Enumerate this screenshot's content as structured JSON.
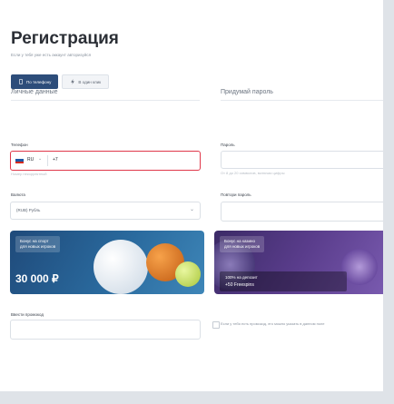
{
  "title": "Регистрация",
  "login_hint": "Если у тебя уже есть аккаунт авторизуйся",
  "tabs": [
    {
      "label": "По телефону"
    },
    {
      "label": "В один клик"
    }
  ],
  "personal": {
    "section_title": "Личные данные",
    "phone_label": "Телефон",
    "country_code": "RU",
    "phone_prefix": "+7",
    "phone_error": "Номер некорректный",
    "currency_label": "Валюта",
    "currency_value": "(RUB) Рубль"
  },
  "password": {
    "section_title": "Придумай пароль",
    "password_label": "Пароль",
    "password_hint": "От 8 до 20 символов, включая цифры",
    "repeat_label": "Повтори пароль"
  },
  "bonuses": {
    "sport": {
      "badge_line1": "Бонус на спорт",
      "badge_line2": "для новых игроков",
      "amount": "30 000 ₽"
    },
    "casino": {
      "badge_line1": "Бонус на казино",
      "badge_line2": "для новых игроков",
      "offer_line1": "100% на депозит",
      "offer_line2": "+50 Freespins"
    }
  },
  "promo": {
    "label": "Ввести промокод",
    "agreement": "Если у тебя есть промокод, его можно указать в данном поле"
  },
  "colors": {
    "accent": "#2d4d7a",
    "error": "#e0384a",
    "sport_bg": "#2a6a9e",
    "casino_bg": "#5a3d8c"
  }
}
